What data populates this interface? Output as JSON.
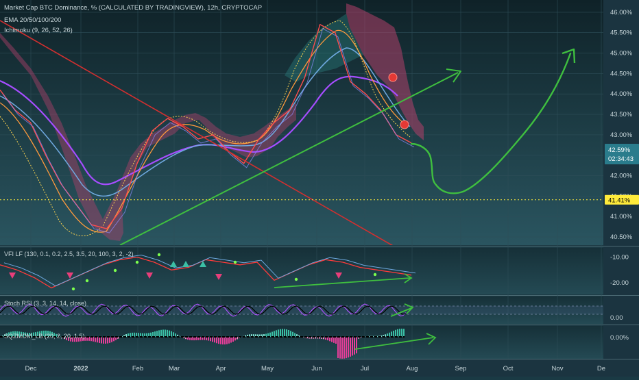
{
  "header": {
    "line1": "Market Cap BTC Dominance, % (CALCULATED BY TRADINGVIEW), 12h, CRYPTOCAP",
    "line2": "EMA 20/50/100/200",
    "line3": "Ichimoku (9, 26, 52, 26)"
  },
  "price_labels": {
    "current": "42.59%",
    "countdown": "02:34:43",
    "level": "41.41%"
  },
  "indicators": {
    "vfi": "VFI LF (130, 0.1, 0.2, 2.5, 3.5, 20, 100, 3, 2, -2)",
    "stoch": "Stoch RSI (3, 3, 14, 14, close)",
    "sqz": "SQZMOM_LB (20, 2, 20, 1.5)"
  },
  "colors": {
    "background_top": "#0f2228",
    "background_bottom": "#2a5560",
    "annotation_green": "#3fbf3f",
    "trendline_red": "#d32f2f",
    "level_yellow": "#ffeb3b",
    "cloud": "#b0406a",
    "ema_purple": "#a64dff",
    "price_label_bg": "#2a7c8c"
  },
  "chart_data": [
    {
      "type": "line",
      "title": "Market Cap BTC Dominance, % (CALCULATED BY TRADINGVIEW), 12h, CRYPTOCAP",
      "x_ticks": [
        "Dec",
        "2022",
        "Feb",
        "Mar",
        "Apr",
        "May",
        "Jun",
        "Jul",
        "Aug",
        "Sep",
        "Oct",
        "Nov",
        "De"
      ],
      "y_ticks": [
        "40.50%",
        "41.00%",
        "41.50%",
        "42.00%",
        "42.50%",
        "43.00%",
        "43.50%",
        "44.00%",
        "44.50%",
        "45.00%",
        "45.50%",
        "46.00%"
      ],
      "ylim": [
        40.3,
        46.3
      ],
      "series": [
        {
          "values": [
            44.1,
            43.6,
            43.3,
            42.5,
            41.8,
            41.3,
            40.8,
            40.7,
            41.2,
            42.3,
            43.1,
            43.4,
            43.2,
            42.9,
            43.0,
            42.6,
            42.3,
            42.9,
            43.3,
            43.6,
            44.4,
            45.7,
            45.5,
            44.3,
            44.0,
            43.6,
            43.0,
            42.8
          ]
        }
      ],
      "current_value": 42.59,
      "horizontal_level": 41.41,
      "grid": true
    },
    {
      "type": "line",
      "title": "VFI LF (130, 0.1, 0.2, 2.5, 3.5, 20, 100, 3, 2, -2)",
      "y_ticks": [
        "-10.00",
        "-20.00"
      ],
      "series": [
        {
          "values": [
            -13,
            -15,
            -18,
            -22,
            -19,
            -16,
            -13,
            -11,
            -10,
            -12,
            -15,
            -14,
            -11,
            -12,
            -13,
            -12,
            -19,
            -16,
            -13,
            -11,
            -12,
            -14,
            -15,
            -16,
            -17
          ]
        }
      ]
    },
    {
      "type": "line",
      "title": "Stoch RSI (3, 3, 14, 14, close)",
      "y_ticks": [
        "0.00"
      ]
    },
    {
      "type": "bar",
      "title": "SQZMOM_LB (20, 2, 20, 1.5)",
      "y_ticks": [
        "0.00%"
      ]
    }
  ]
}
